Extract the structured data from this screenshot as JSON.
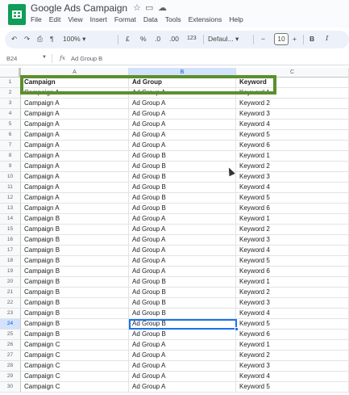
{
  "app": {
    "title": "Google Ads Campaign",
    "title_icons": [
      "star-icon",
      "move-to-folder-icon",
      "cloud-status-icon"
    ],
    "menu": [
      "File",
      "Edit",
      "View",
      "Insert",
      "Format",
      "Data",
      "Tools",
      "Extensions",
      "Help"
    ]
  },
  "toolbar": {
    "undo": "↶",
    "redo": "↷",
    "print": "⎙",
    "paint_format": "¶",
    "zoom": "100%",
    "currency": "£",
    "percent": "%",
    "decrease_decimal": ".0",
    "increase_decimal": ".00",
    "number_format": "123",
    "font": "Defaul...",
    "font_size": "10",
    "minus": "−",
    "plus": "+",
    "bold": "B",
    "italic": "I"
  },
  "formula_bar": {
    "cell_ref": "B24",
    "fx": "fx",
    "value": "Ad Group B"
  },
  "columns": [
    "A",
    "B",
    "C"
  ],
  "selected_column": "B",
  "selected_row": 24,
  "rows": [
    {
      "n": "1",
      "a": "Campaign",
      "b": "Ad Group",
      "c": "Keyword"
    },
    {
      "n": "2",
      "a": "Campaign A",
      "b": "Ad Group A",
      "c": "Keyword 1"
    },
    {
      "n": "3",
      "a": "Campaign A",
      "b": "Ad Group A",
      "c": "Keyword 2"
    },
    {
      "n": "4",
      "a": "Campaign A",
      "b": "Ad Group A",
      "c": "Keyword 3"
    },
    {
      "n": "5",
      "a": "Campaign A",
      "b": "Ad Group A",
      "c": "Keyword 4"
    },
    {
      "n": "6",
      "a": "Campaign A",
      "b": "Ad Group A",
      "c": "Keyword 5"
    },
    {
      "n": "7",
      "a": "Campaign A",
      "b": "Ad Group A",
      "c": "Keyword 6"
    },
    {
      "n": "8",
      "a": "Campaign A",
      "b": "Ad Group B",
      "c": "Keyword 1"
    },
    {
      "n": "9",
      "a": "Campaign A",
      "b": "Ad Group B",
      "c": "Keyword 2"
    },
    {
      "n": "10",
      "a": "Campaign A",
      "b": "Ad Group B",
      "c": "Keyword 3"
    },
    {
      "n": "11",
      "a": "Campaign A",
      "b": "Ad Group B",
      "c": "Keyword 4"
    },
    {
      "n": "12",
      "a": "Campaign A",
      "b": "Ad Group B",
      "c": "Keyword 5"
    },
    {
      "n": "13",
      "a": "Campaign A",
      "b": "Ad Group B",
      "c": "Keyword 6"
    },
    {
      "n": "14",
      "a": "Campaign B",
      "b": "Ad Group A",
      "c": "Keyword 1"
    },
    {
      "n": "15",
      "a": "Campaign B",
      "b": "Ad Group A",
      "c": "Keyword 2"
    },
    {
      "n": "16",
      "a": "Campaign B",
      "b": "Ad Group A",
      "c": "Keyword 3"
    },
    {
      "n": "17",
      "a": "Campaign B",
      "b": "Ad Group A",
      "c": "Keyword 4"
    },
    {
      "n": "18",
      "a": "Campaign B",
      "b": "Ad Group A",
      "c": "Keyword 5"
    },
    {
      "n": "19",
      "a": "Campaign B",
      "b": "Ad Group A",
      "c": "Keyword 6"
    },
    {
      "n": "20",
      "a": "Campaign B",
      "b": "Ad Group B",
      "c": "Keyword 1"
    },
    {
      "n": "21",
      "a": "Campaign B",
      "b": "Ad Group B",
      "c": "Keyword 2"
    },
    {
      "n": "22",
      "a": "Campaign B",
      "b": "Ad Group B",
      "c": "Keyword 3"
    },
    {
      "n": "23",
      "a": "Campaign B",
      "b": "Ad Group B",
      "c": "Keyword 4"
    },
    {
      "n": "24",
      "a": "Campaign B",
      "b": "Ad Group B",
      "c": "Keyword 5"
    },
    {
      "n": "25",
      "a": "Campaign B",
      "b": "Ad Group B",
      "c": "Keyword 6"
    },
    {
      "n": "26",
      "a": "Campaign C",
      "b": "Ad Group A",
      "c": "Keyword 1"
    },
    {
      "n": "27",
      "a": "Campaign C",
      "b": "Ad Group A",
      "c": "Keyword 2"
    },
    {
      "n": "28",
      "a": "Campaign C",
      "b": "Ad Group A",
      "c": "Keyword 3"
    },
    {
      "n": "29",
      "a": "Campaign C",
      "b": "Ad Group A",
      "c": "Keyword 4"
    },
    {
      "n": "30",
      "a": "Campaign C",
      "b": "Ad Group A",
      "c": "Keyword 5"
    }
  ],
  "colors": {
    "highlight_border": "#5b8f2c",
    "selection": "#1a73e8",
    "logo": "#0f9d58"
  }
}
